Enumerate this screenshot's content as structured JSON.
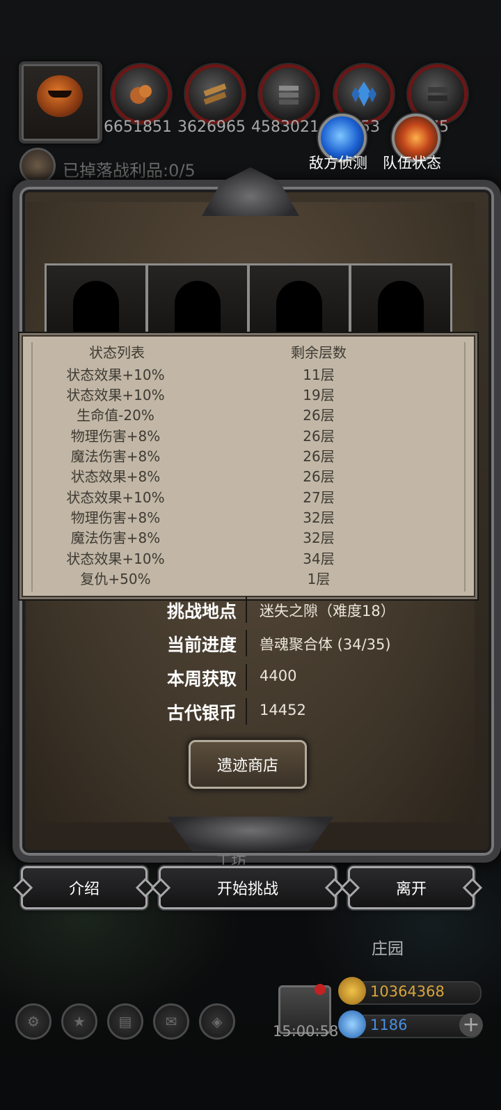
{
  "resources": [
    {
      "icon": "copper-ore-icon",
      "value": "6651851"
    },
    {
      "icon": "wood-planks-icon",
      "value": "3626965"
    },
    {
      "icon": "iron-bars-icon",
      "value": "4583021"
    },
    {
      "icon": "blue-crystal-icon",
      "value": "4053"
    },
    {
      "icon": "dark-ore-icon",
      "value": "275"
    }
  ],
  "actions": {
    "enemy_scout": "敌方侦测",
    "team_status": "队伍状态"
  },
  "loot": {
    "text": "已掉落战利品:0/5"
  },
  "status": {
    "header_left": "状态列表",
    "header_right": "剩余层数",
    "rows": [
      {
        "name": "状态效果+10%",
        "layers": "11层"
      },
      {
        "name": "状态效果+10%",
        "layers": "19层"
      },
      {
        "name": "生命值-20%",
        "layers": "26层"
      },
      {
        "name": "物理伤害+8%",
        "layers": "26层"
      },
      {
        "name": "魔法伤害+8%",
        "layers": "26层"
      },
      {
        "name": "状态效果+8%",
        "layers": "26层"
      },
      {
        "name": "状态效果+10%",
        "layers": "27层"
      },
      {
        "name": "物理伤害+8%",
        "layers": "32层"
      },
      {
        "name": "魔法伤害+8%",
        "layers": "32层"
      },
      {
        "name": "状态效果+10%",
        "layers": "34层"
      },
      {
        "name": "复仇+50%",
        "layers": "1层"
      }
    ]
  },
  "info": {
    "location_label": "挑战地点",
    "location_value": "迷失之隙（难度18）",
    "progress_label": "当前进度",
    "progress_value": "兽魂聚合体 (34/35)",
    "weekly_label": "本周获取",
    "weekly_value": "4400",
    "coin_label": "古代银币",
    "coin_value": "14452"
  },
  "shop_button": "遗迹商店",
  "background_labels": {
    "workshop": "工坊",
    "manor": "庄园"
  },
  "buttons": {
    "intro": "介绍",
    "start": "开始挑战",
    "leave": "离开"
  },
  "bottom": {
    "timer": "15:00:58",
    "gold": "10364368",
    "gems": "1186"
  },
  "colors": {
    "gold_text": "#d9a53a",
    "gem_text": "#4a8fe0",
    "panel_bg": "#c2b7a6",
    "frame_border": "#3d3d3f"
  }
}
